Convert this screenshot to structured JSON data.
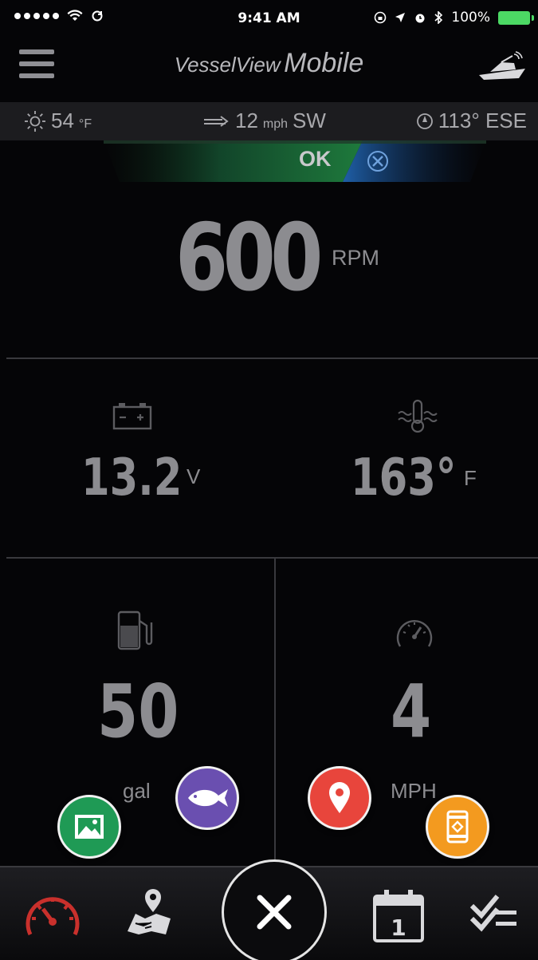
{
  "status_bar": {
    "time": "9:41 AM",
    "battery": "100%"
  },
  "header": {
    "title_prefix": "VesselView",
    "title_suffix": "Mobile"
  },
  "weather": {
    "temp": "54",
    "temp_unit": "°F",
    "wind_speed": "12",
    "wind_unit": "mph",
    "wind_dir": "SW",
    "heading": "113° ESE"
  },
  "engine_status": {
    "label": "OK"
  },
  "gauges": {
    "rpm": {
      "value": "600",
      "unit": "RPM"
    },
    "battery": {
      "value": "13.2",
      "unit": "V"
    },
    "temperature": {
      "value": "163°",
      "unit": "F"
    },
    "fuel": {
      "value": "50",
      "unit": "gal"
    },
    "speed": {
      "value": "4",
      "unit": "MPH"
    }
  },
  "colors": {
    "ok_green": "#1e7a3c",
    "service_blue": "#1f5fa8",
    "fab_green": "#1f9a55",
    "fab_purple": "#6a4fb0",
    "fab_red": "#e8453c",
    "fab_orange": "#f39a1f",
    "active_tab_red": "#c9302c"
  },
  "icons": [
    "menu-icon",
    "boat-icon",
    "sun-icon",
    "wind-icon",
    "compass-icon",
    "wrench-screwdriver-icon",
    "battery-icon",
    "coolant-temp-icon",
    "fuel-pump-icon",
    "speedometer-icon",
    "gallery-icon",
    "fish-icon",
    "location-pin-icon",
    "phone-icon",
    "gauges-tab-icon",
    "map-tab-icon",
    "close-icon",
    "calendar-tab-icon",
    "checklist-tab-icon"
  ],
  "calendar_day": "1"
}
